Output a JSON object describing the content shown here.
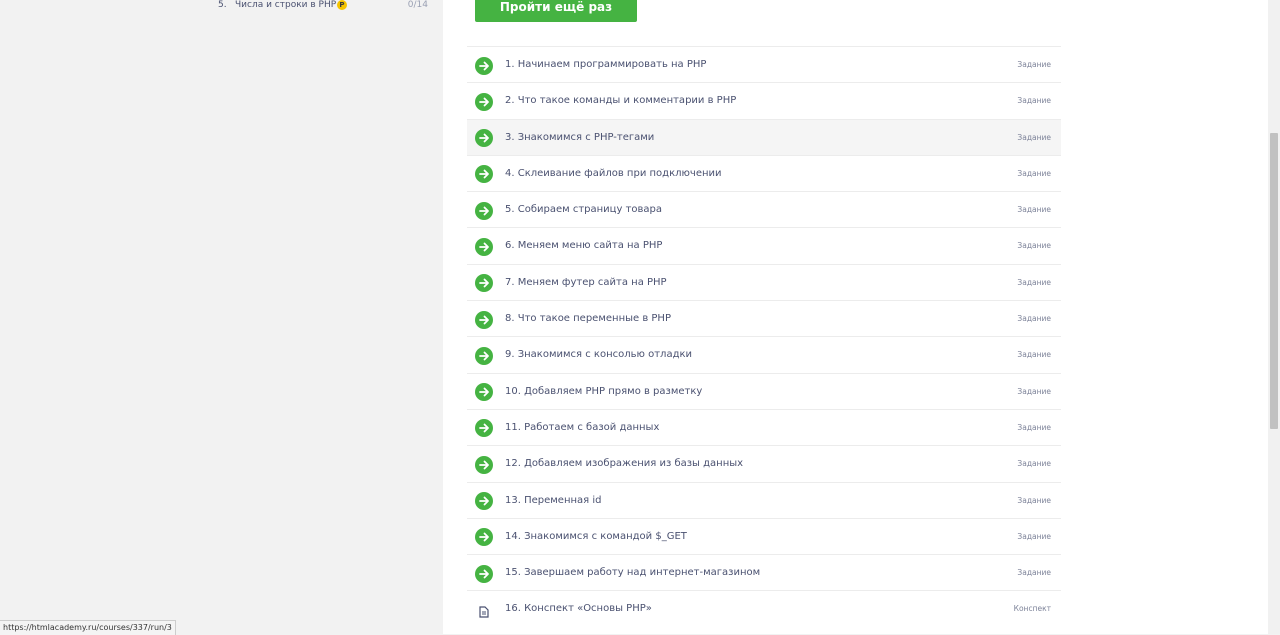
{
  "sidebar": {
    "item": {
      "number": "5.",
      "title": "Числа и строки в PHP",
      "badge": "P",
      "progress": "0/14"
    }
  },
  "main": {
    "retry_label": "Пройти ещё раз",
    "lessons": [
      {
        "title": "1. Начинаем программировать на PHP",
        "type": "Задание",
        "icon": "done-arrow-icon"
      },
      {
        "title": "2. Что такое команды и комментарии в PHP",
        "type": "Задание",
        "icon": "done-arrow-icon"
      },
      {
        "title": "3. Знакомимся с PHP-тегами",
        "type": "Задание",
        "icon": "done-arrow-icon"
      },
      {
        "title": "4. Склеивание файлов при подключении",
        "type": "Задание",
        "icon": "done-arrow-icon"
      },
      {
        "title": "5. Собираем страницу товара",
        "type": "Задание",
        "icon": "done-arrow-icon"
      },
      {
        "title": "6. Меняем меню сайта на PHP",
        "type": "Задание",
        "icon": "done-arrow-icon"
      },
      {
        "title": "7. Меняем футер сайта на PHP",
        "type": "Задание",
        "icon": "done-arrow-icon"
      },
      {
        "title": "8. Что такое переменные в PHP",
        "type": "Задание",
        "icon": "done-arrow-icon"
      },
      {
        "title": "9. Знакомимся с консолью отладки",
        "type": "Задание",
        "icon": "done-arrow-icon"
      },
      {
        "title": "10. Добавляем PHP прямо в разметку",
        "type": "Задание",
        "icon": "done-arrow-icon"
      },
      {
        "title": "11. Работаем с базой данных",
        "type": "Задание",
        "icon": "done-arrow-icon"
      },
      {
        "title": "12. Добавляем изображения из базы данных",
        "type": "Задание",
        "icon": "done-arrow-icon"
      },
      {
        "title": "13. Переменная id",
        "type": "Задание",
        "icon": "done-arrow-icon"
      },
      {
        "title": "14. Знакомимся с командой $_GET",
        "type": "Задание",
        "icon": "done-arrow-icon"
      },
      {
        "title": "15. Завершаем работу над интернет-магазином",
        "type": "Задание",
        "icon": "done-arrow-icon"
      },
      {
        "title": "16. Конспект «Основы PHP»",
        "type": "Конспект",
        "icon": "document-icon"
      }
    ]
  },
  "status_bar": {
    "url": "https://htmlacademy.ru/courses/337/run/3"
  },
  "colors": {
    "accent": "#45b342",
    "text": "#4a5170",
    "badge": "#f5c400"
  }
}
